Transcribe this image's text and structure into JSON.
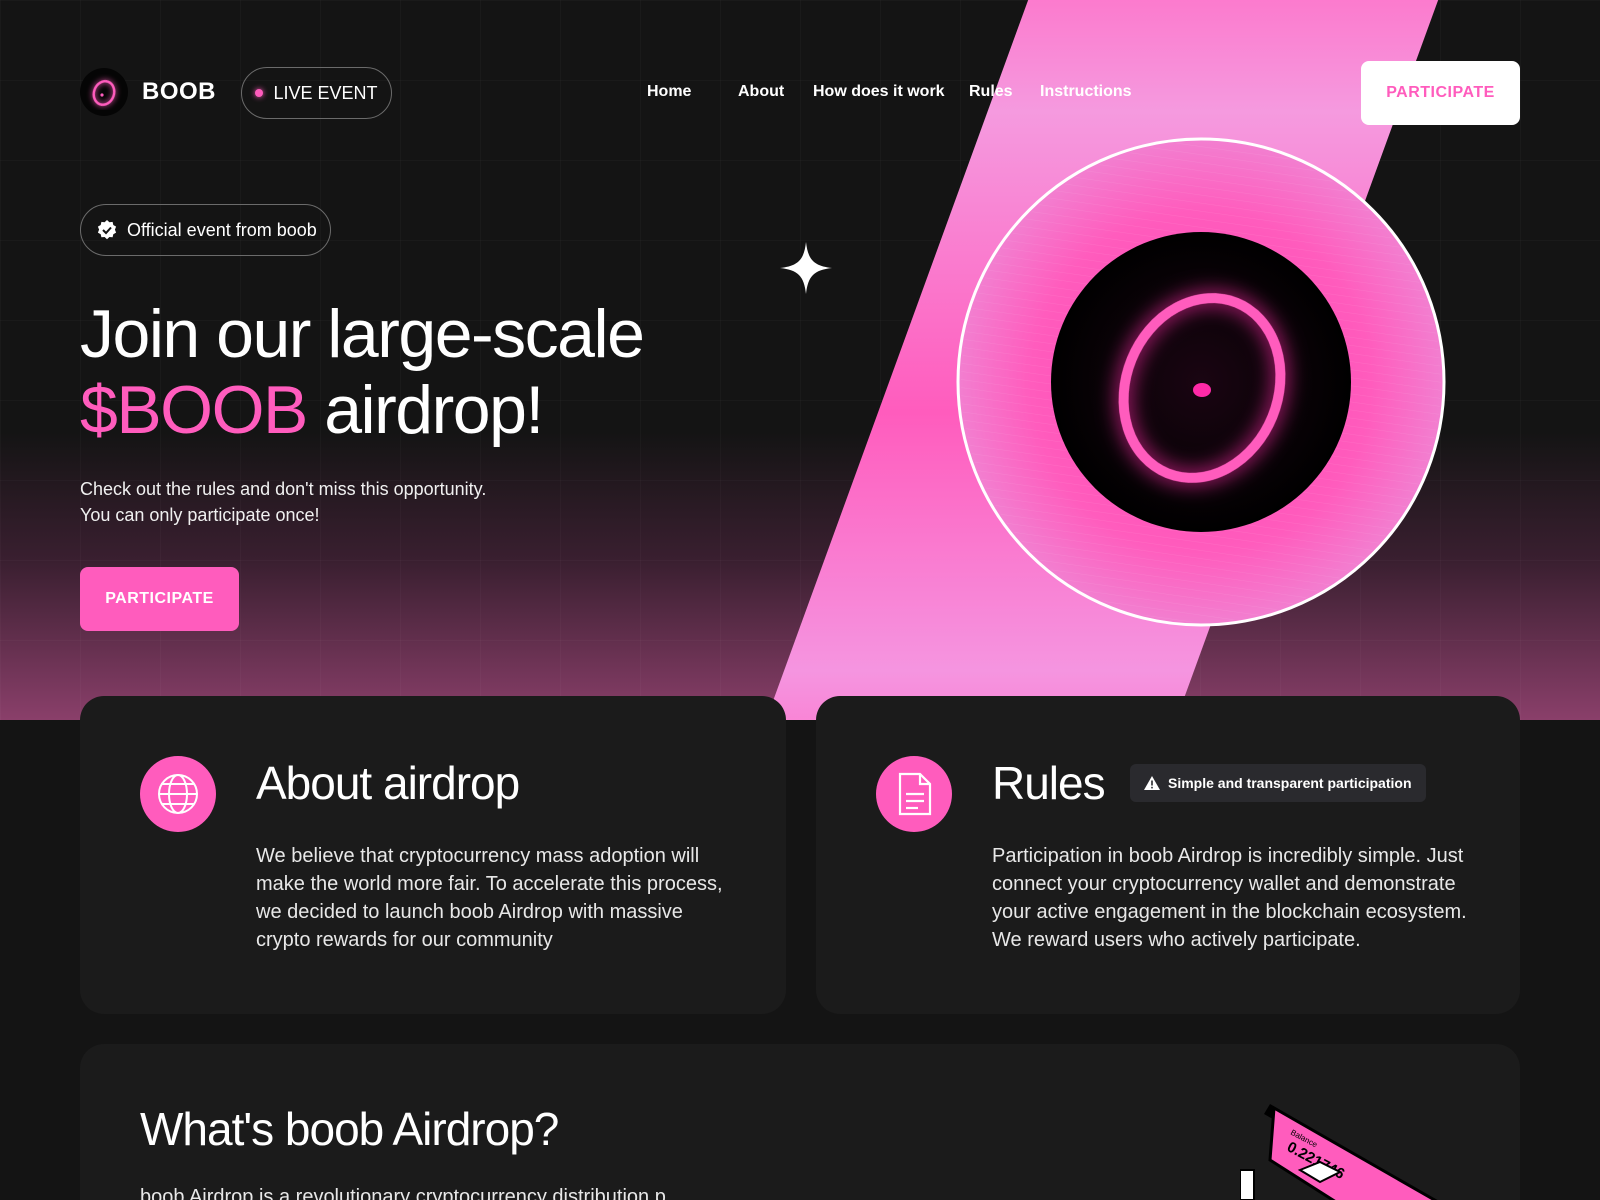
{
  "header": {
    "brand": "BOOB",
    "live_label": "LIVE EVENT",
    "nav": [
      "Home",
      "About",
      "How does it work",
      "Rules",
      "Instructions"
    ],
    "participate_label": "PARTICIPATE"
  },
  "hero": {
    "badge": "Official event from boob",
    "title_line1": "Join our large-scale",
    "title_highlight": "$BOOB",
    "title_line2_rest": " airdrop!",
    "subtitle_line1": "Check out the rules and don't miss this opportunity.",
    "subtitle_line2": "You can only participate once!",
    "cta_label": "PARTICIPATE"
  },
  "about": {
    "title": "About airdrop",
    "body": "We believe that cryptocurrency mass adoption will make the world more fair. To accelerate this process, we decided to launch boob Airdrop with massive crypto rewards for our community"
  },
  "rules": {
    "title": "Rules",
    "badge": "Simple and transparent participation",
    "body": "Participation in boob Airdrop is incredibly simple. Just connect your cryptocurrency wallet and demonstrate your active engagement in the blockchain ecosystem. We reward users who actively participate."
  },
  "what": {
    "title": "What's boob Airdrop?",
    "body": "boob Airdrop is a revolutionary cryptocurrency distribution p"
  },
  "device": {
    "label": "Balance",
    "value": "0.221746"
  },
  "colors": {
    "accent": "#ff5cbd",
    "background": "#141414",
    "card": "#1b1b1b"
  }
}
